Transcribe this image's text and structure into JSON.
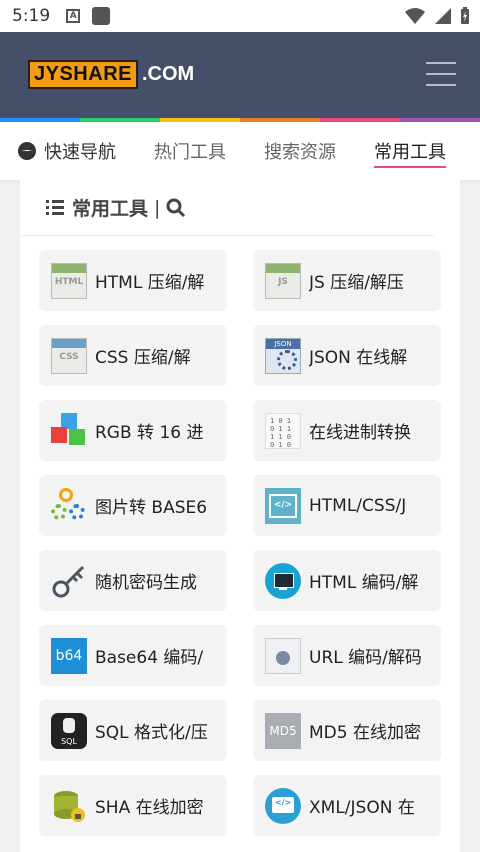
{
  "status_bar": {
    "time": "5:19",
    "notif_letter": "A"
  },
  "header": {
    "logo_main": "JYSHARE",
    "logo_suffix": ".COM"
  },
  "rainbow_colors": [
    "#1e90ff",
    "#2ecc71",
    "#f1c40f",
    "#e67e22",
    "#e84a7f",
    "#9b59b6"
  ],
  "tabs": [
    {
      "label": "快速导航"
    },
    {
      "label": "热门工具"
    },
    {
      "label": "搜索资源"
    },
    {
      "label": "常用工具"
    }
  ],
  "panel": {
    "title": "常用工具",
    "separator": "|",
    "tools": [
      {
        "label": "HTML 压缩/解",
        "icon": "html-file-icon",
        "icon_text": "HTML"
      },
      {
        "label": "JS 压缩/解压",
        "icon": "js-file-icon",
        "icon_text": "JS"
      },
      {
        "label": "CSS 压缩/解",
        "icon": "css-file-icon",
        "icon_text": "CSS"
      },
      {
        "label": "JSON 在线解",
        "icon": "json-gear-icon",
        "icon_text": ""
      },
      {
        "label": "RGB 转 16 进",
        "icon": "rgb-cubes-icon",
        "icon_text": ""
      },
      {
        "label": "在线进制转换",
        "icon": "binary-sheet-icon",
        "icon_text": ""
      },
      {
        "label": "图片转 BASE6",
        "icon": "gears-icon",
        "icon_text": ""
      },
      {
        "label": "HTML/CSS/J",
        "icon": "code-window-icon",
        "icon_text": "</>"
      },
      {
        "label": "随机密码生成",
        "icon": "key-icon",
        "icon_text": ""
      },
      {
        "label": "HTML 编码/解",
        "icon": "monitor-circle-icon",
        "icon_text": ""
      },
      {
        "label": "Base64 编码/",
        "icon": "b64-icon",
        "icon_text": "b64"
      },
      {
        "label": "URL 编码/解码",
        "icon": "url-doc-icon",
        "icon_text": ""
      },
      {
        "label": "SQL 格式化/压",
        "icon": "sql-icon",
        "icon_text": "SQL"
      },
      {
        "label": "MD5 在线加密",
        "icon": "md5-icon",
        "icon_text": "MD5"
      },
      {
        "label": "SHA 在线加密",
        "icon": "database-lock-icon",
        "icon_text": ""
      },
      {
        "label": "XML/JSON 在",
        "icon": "xml-monitor-icon",
        "icon_text": "</>"
      }
    ]
  }
}
